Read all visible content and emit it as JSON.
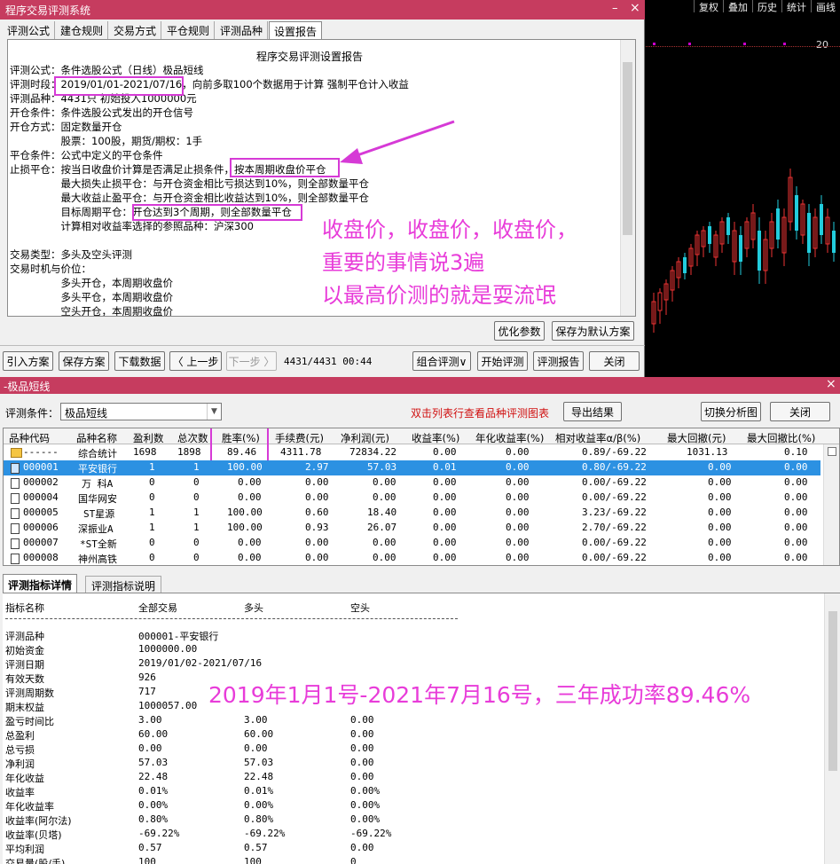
{
  "win1": {
    "title": "程序交易评测系统",
    "min": "–",
    "close": "×",
    "tabs": [
      "评测公式",
      "建仓规则",
      "交易方式",
      "平仓规则",
      "评测品种",
      "设置报告"
    ],
    "report_title": "程序交易评测设置报告",
    "lines": [
      "评测公式：条件选股公式（日线）极品短线",
      "评测时段：2019/01/01-2021/07/16，向前多取100个数据用于计算 强制平仓计入收益",
      "评测品种：4431只 初始投入1000000元",
      "开仓条件：条件选股公式发出的开仓信号",
      "开仓方式：固定数量开仓",
      "　　　　　股票：100股，期货/期权：1手",
      "平仓条件：公式中定义的平仓条件",
      "止损平仓：按当日收盘价计算是否满足止损条件，按本周期收盘价平仓",
      "　　　　　最大损失止损平仓：与开仓资金相比亏损达到10%，则全部数量平仓",
      "　　　　　最大收益止盈平仓：与开仓资金相比收益达到10%，则全部数量平仓",
      "　　　　　目标周期平仓：开仓达到3个周期，则全部数量平仓",
      "　　　　　计算相对收益率选择的参照品种：沪深300",
      "",
      "交易类型：多头及空头评测",
      "交易时机与价位：",
      "　　　　　多头开仓，本周期收盘价",
      "　　　　　多头平仓，本周期收盘价",
      "　　　　　空头开仓，本周期收盘价"
    ],
    "annotation": [
      "收盘价，收盘价，收盘价，",
      "重要的事情说3遍",
      "以最高价测的就是耍流氓"
    ],
    "btn_opt": "优化参数",
    "btn_save_default": "保存为默认方案",
    "toolbar": [
      "引入方案",
      "保存方案",
      "下载数据",
      "〈 上一步",
      "下一步 〉"
    ],
    "progress": "4431/4431 00:44",
    "btn_combo": "组合评测∨",
    "btn_start": "开始评测",
    "btn_report": "评测报告",
    "btn_close": "关闭"
  },
  "chart": {
    "menu": [
      "复权",
      "叠加",
      "历史",
      "统计",
      "画线"
    ],
    "label": "20"
  },
  "win2": {
    "title": "-极品短线",
    "close": "×",
    "cond_label": "评测条件：",
    "cond_value": "极品短线",
    "hint": "双击列表行查看品种评测图表",
    "btn_export": "导出结果",
    "btn_switch": "切换分析图",
    "btn_close": "关闭",
    "headers": [
      "品种代码",
      "品种名称",
      "盈利数",
      "总次数",
      "胜率(%)",
      "手续费(元)",
      "净利润(元)",
      "收益率(%)",
      "年化收益率(%)",
      "相对收益率α/β(%)",
      "最大回撤(元)",
      "最大回撤比(%)"
    ],
    "rows": [
      [
        "------",
        "综合统计",
        "1698",
        "1898",
        "89.46",
        "4311.78",
        "72834.22",
        "0.00",
        "0.00",
        "0.89/-69.22",
        "1031.13",
        "0.10"
      ],
      [
        "000001",
        "平安银行",
        "1",
        "1",
        "100.00",
        "2.97",
        "57.03",
        "0.01",
        "0.00",
        "0.80/-69.22",
        "0.00",
        "0.00"
      ],
      [
        "000002",
        "万 科A",
        "0",
        "0",
        "0.00",
        "0.00",
        "0.00",
        "0.00",
        "0.00",
        "0.00/-69.22",
        "0.00",
        "0.00"
      ],
      [
        "000004",
        "国华网安",
        "0",
        "0",
        "0.00",
        "0.00",
        "0.00",
        "0.00",
        "0.00",
        "0.00/-69.22",
        "0.00",
        "0.00"
      ],
      [
        "000005",
        "ST星源",
        "1",
        "1",
        "100.00",
        "0.60",
        "18.40",
        "0.00",
        "0.00",
        "3.23/-69.22",
        "0.00",
        "0.00"
      ],
      [
        "000006",
        "深振业A",
        "1",
        "1",
        "100.00",
        "0.93",
        "26.07",
        "0.00",
        "0.00",
        "2.70/-69.22",
        "0.00",
        "0.00"
      ],
      [
        "000007",
        "*ST全新",
        "0",
        "0",
        "0.00",
        "0.00",
        "0.00",
        "0.00",
        "0.00",
        "0.00/-69.22",
        "0.00",
        "0.00"
      ],
      [
        "000008",
        "神州高铁",
        "0",
        "0",
        "0.00",
        "0.00",
        "0.00",
        "0.00",
        "0.00",
        "0.00/-69.22",
        "0.00",
        "0.00"
      ]
    ],
    "detail_tabs": [
      "评测指标详情",
      "评测指标说明"
    ],
    "detail_headers": [
      "指标名称",
      "全部交易",
      "多头",
      "空头"
    ],
    "detail_rows": [
      [
        "评测品种",
        "000001-平安银行",
        "",
        ""
      ],
      [
        "初始资金",
        "1000000.00",
        "",
        ""
      ],
      [
        "评测日期",
        "2019/01/02-2021/07/16",
        "",
        ""
      ],
      [
        "有效天数",
        "926",
        "",
        ""
      ],
      [
        "评测周期数",
        "717",
        "",
        ""
      ],
      [
        "期末权益",
        "1000057.00",
        "",
        ""
      ],
      [
        "盈亏时间比",
        "3.00",
        "3.00",
        "0.00"
      ],
      [
        "总盈利",
        "60.00",
        "60.00",
        "0.00"
      ],
      [
        "总亏损",
        "0.00",
        "0.00",
        "0.00"
      ],
      [
        "净利润",
        "57.03",
        "57.03",
        "0.00"
      ],
      [
        "年化收益",
        "22.48",
        "22.48",
        "0.00"
      ],
      [
        "收益率",
        "0.01%",
        "0.01%",
        "0.00%"
      ],
      [
        "年化收益率",
        "0.00%",
        "0.00%",
        "0.00%"
      ],
      [
        "收益率(阿尔法)",
        "0.80%",
        "0.80%",
        "0.00%"
      ],
      [
        "收益率(贝塔)",
        "-69.22%",
        "-69.22%",
        "-69.22%"
      ],
      [
        "平均利润",
        "0.57",
        "0.57",
        "0.00"
      ],
      [
        "交易量(股/手)",
        "100",
        "100",
        "0"
      ]
    ],
    "annotation2": "2019年1月1号-2021年7月16号，三年成功率89.46%"
  }
}
